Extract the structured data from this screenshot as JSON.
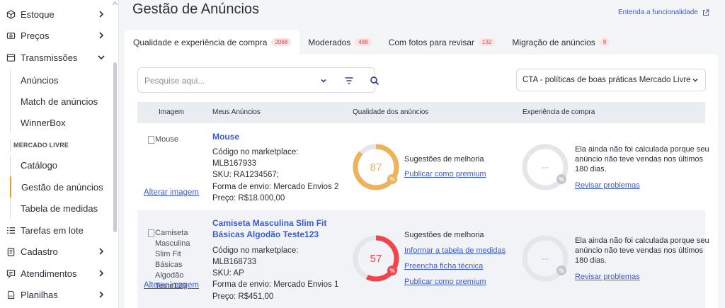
{
  "sidebar": {
    "items": [
      {
        "label": "Estoque",
        "icon": "box-icon"
      },
      {
        "label": "Preços",
        "icon": "tag-icon"
      },
      {
        "label": "Transmissões",
        "icon": "transmission-icon"
      },
      {
        "label": "Anúncios"
      },
      {
        "label": "Match de anúncios"
      },
      {
        "label": "WinnerBox"
      },
      {
        "label": "MERCADO LIVRE"
      },
      {
        "label": "Catálogo"
      },
      {
        "label": "Gestão de anúncios"
      },
      {
        "label": "Tabela de medidas"
      },
      {
        "label": "Tarefas em lote",
        "icon": "list-icon"
      },
      {
        "label": "Cadastro",
        "icon": "clipboard-icon"
      },
      {
        "label": "Atendimentos",
        "icon": "chat-icon"
      },
      {
        "label": "Planilhas",
        "icon": "spreadsheet-icon"
      }
    ]
  },
  "header": {
    "title": "Gestão de Anúncios",
    "help_link": "Entenda a funcionalidade"
  },
  "tabs": [
    {
      "label": "Qualidade e experiência de compra",
      "count": "2068"
    },
    {
      "label": "Moderados",
      "count": "488"
    },
    {
      "label": "Com fotos para revisar",
      "count": "132"
    },
    {
      "label": "Migração de anúncios",
      "count": "8"
    }
  ],
  "search": {
    "placeholder": "Pesquise aqui..."
  },
  "cta_filter": {
    "value": "CTA - políticas de boas práticas Mercado Livre"
  },
  "table": {
    "headers": [
      "Imagem",
      "Meus Anúncios",
      "Qualidade dos anúncios",
      "Experiência de compra"
    ],
    "rows": [
      {
        "image_alt": "Mouse",
        "change_image": "Alterar imagem",
        "title": "Mouse",
        "marketplace_label": "Código no marketplace:",
        "marketplace_code": "MLB167933",
        "sku": "SKU: RA1234567;",
        "shipping": "Forma de envio: Mercado Envios 2",
        "price": "Preço: R$18.000,00",
        "quality_score": 87,
        "quality_color": "#eeb25a",
        "quality_label": "Sugestões de melhoria",
        "quality_actions": [
          "Publicar como premium"
        ],
        "experience_text": "Ela ainda não foi calculada porque seu anúncio não teve vendas nos últimos 180 dias.",
        "experience_score": "--",
        "experience_action": "Revisar problemas"
      },
      {
        "image_alt": "Camiseta Masculina Slim Fit Básicas Algodão Teste123",
        "change_image": "Alterar imagem",
        "title": "Camiseta Masculina Slim Fit Básicas Algodão Teste123",
        "marketplace_label": "Código no marketplace:",
        "marketplace_code": "MLB168733",
        "sku": "SKU: AP",
        "shipping": "Forma de envio: Mercado Envios 1",
        "price": "Preço: R$451,00",
        "quality_score": 57,
        "quality_color": "#f0454a",
        "quality_label": "Sugestões de melhoria",
        "quality_actions": [
          "Informar a tabela de medidas",
          "Preencha ficha técnica",
          "Publicar como premium"
        ],
        "experience_text": "Ela ainda não foi calculada porque seu anúncio não teve vendas nos últimos 180 dias.",
        "experience_score": "--",
        "experience_action": "Revisar problemas"
      }
    ]
  },
  "colors": {
    "accent": "#3a5bd9",
    "active_marker": "#f0992c",
    "badge_text": "#e0494a",
    "badge_bg": "#fde3e3"
  }
}
